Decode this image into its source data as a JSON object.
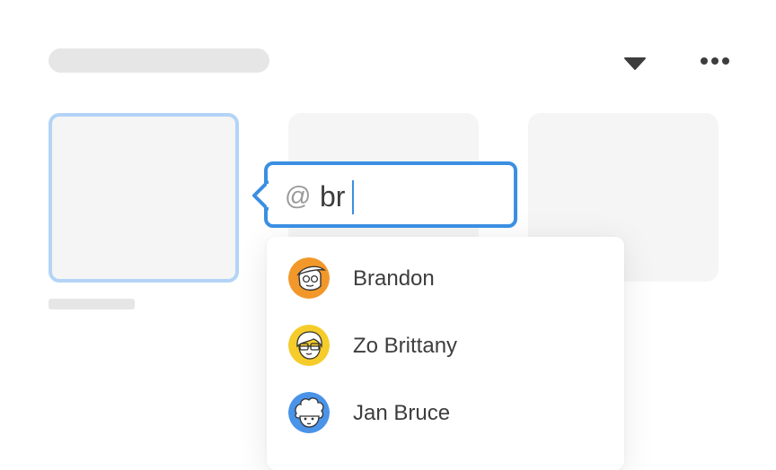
{
  "toolbar": {
    "caret_icon": "caret-down-icon",
    "more_icon": "more-horizontal-icon"
  },
  "mention": {
    "trigger": "@",
    "query": "br"
  },
  "suggestions": [
    {
      "name": "Brandon",
      "avatar_color": "#f2982a"
    },
    {
      "name": "Zo Brittany",
      "avatar_color": "#f5cc2a"
    },
    {
      "name": "Jan Bruce",
      "avatar_color": "#4a93e8"
    }
  ],
  "colors": {
    "accent": "#3b8fe2",
    "selected_card_border": "#b3d4f6",
    "placeholder": "#e6e6e6",
    "card_fill": "#f5f5f5"
  }
}
